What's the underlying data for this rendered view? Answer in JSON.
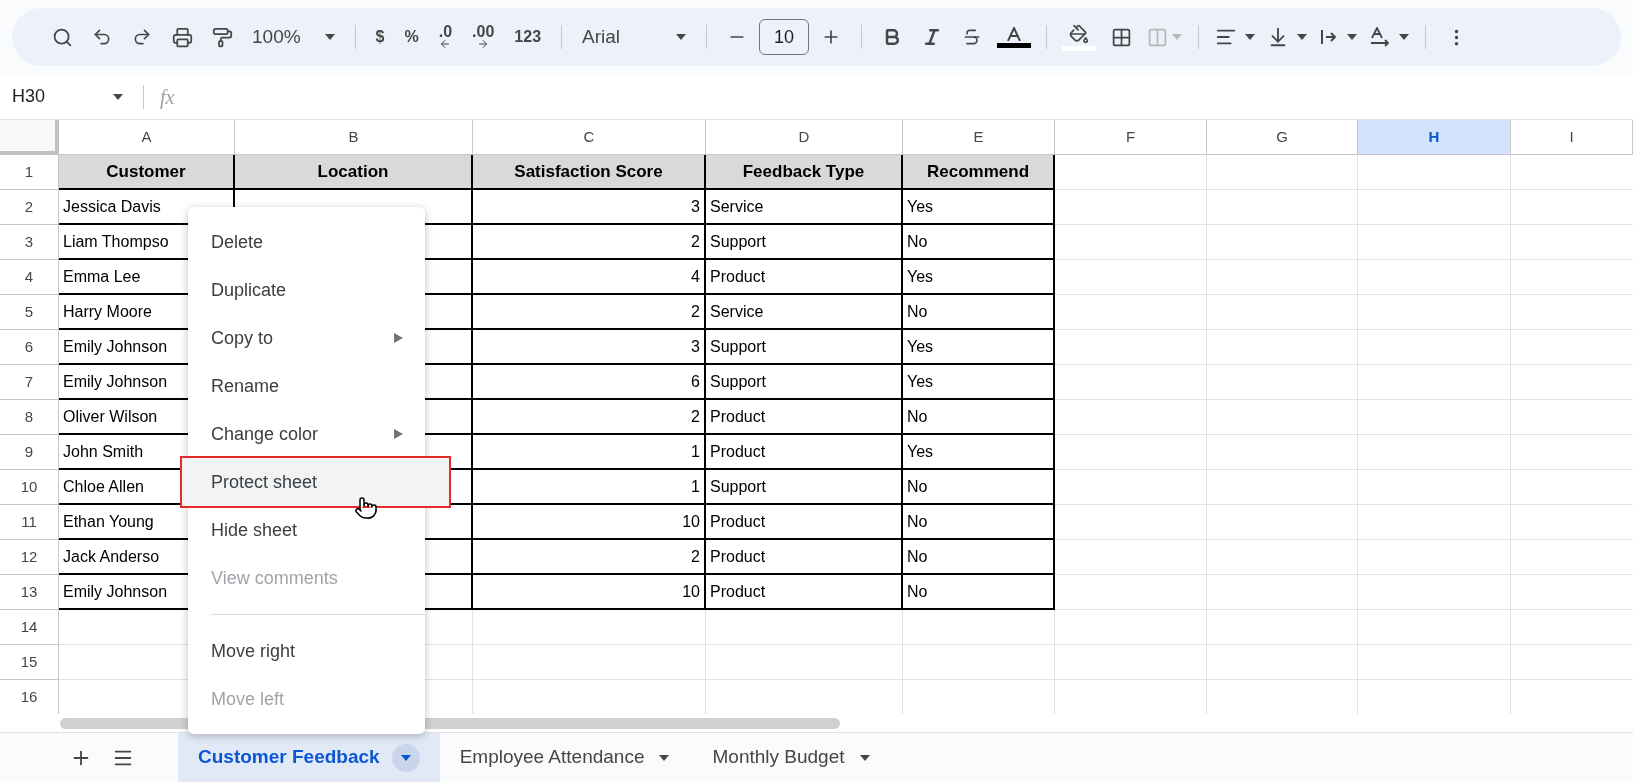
{
  "toolbar": {
    "zoom": "100%",
    "format_buttons": [
      {
        "label": "$",
        "kind": "plain"
      },
      {
        "label": "%",
        "kind": "plain"
      },
      {
        "label": ".0",
        "kind": "decrease"
      },
      {
        "label": ".00",
        "kind": "increase"
      },
      {
        "label": "123",
        "kind": "plain"
      }
    ],
    "font": "Arial",
    "font_size": "10"
  },
  "formula_bar": {
    "cell_ref": "H30",
    "fx": "fx"
  },
  "columns": [
    {
      "letter": "A",
      "selected": false
    },
    {
      "letter": "B",
      "selected": false
    },
    {
      "letter": "C",
      "selected": false
    },
    {
      "letter": "D",
      "selected": false
    },
    {
      "letter": "E",
      "selected": false
    },
    {
      "letter": "F",
      "selected": false
    },
    {
      "letter": "G",
      "selected": false
    },
    {
      "letter": "H",
      "selected": true
    },
    {
      "letter": "I",
      "selected": false
    }
  ],
  "row_numbers": [
    "1",
    "2",
    "3",
    "4",
    "5",
    "6",
    "7",
    "8",
    "9",
    "10",
    "11",
    "12",
    "13",
    "14",
    "15",
    "16"
  ],
  "table": {
    "header": [
      "Customer",
      "Location",
      "Satisfaction Score",
      "Feedback Type",
      "Recommend"
    ],
    "rows": [
      {
        "customer": "Jessica Davis",
        "score": "3",
        "feedback_type": "Service",
        "recommend": "Yes"
      },
      {
        "customer": "Liam Thompso",
        "score": "2",
        "feedback_type": "Support",
        "recommend": "No"
      },
      {
        "customer": "Emma Lee",
        "score": "4",
        "feedback_type": "Product",
        "recommend": "Yes"
      },
      {
        "customer": "Harry Moore",
        "score": "2",
        "feedback_type": "Service",
        "recommend": "No"
      },
      {
        "customer": "Emily Johnson",
        "score": "3",
        "feedback_type": "Support",
        "recommend": "Yes"
      },
      {
        "customer": "Emily Johnson",
        "score": "6",
        "feedback_type": "Support",
        "recommend": "Yes"
      },
      {
        "customer": "Oliver Wilson",
        "score": "2",
        "feedback_type": "Product",
        "recommend": "No"
      },
      {
        "customer": "John Smith",
        "score": "1",
        "feedback_type": "Product",
        "recommend": "Yes"
      },
      {
        "customer": "Chloe Allen",
        "score": "1",
        "feedback_type": "Support",
        "recommend": "No"
      },
      {
        "customer": "Ethan Young",
        "score": "10",
        "feedback_type": "Product",
        "recommend": "No"
      },
      {
        "customer": "Jack Anderso",
        "score": "2",
        "feedback_type": "Product",
        "recommend": "No"
      },
      {
        "customer": "Emily Johnson",
        "score": "10",
        "feedback_type": "Product",
        "recommend": "No"
      }
    ]
  },
  "context_menu": {
    "items": [
      {
        "kind": "item",
        "label": "Delete",
        "disabled": false,
        "submenu": false,
        "highlighted": false
      },
      {
        "kind": "item",
        "label": "Duplicate",
        "disabled": false,
        "submenu": false,
        "highlighted": false
      },
      {
        "kind": "item",
        "label": "Copy to",
        "disabled": false,
        "submenu": true,
        "highlighted": false
      },
      {
        "kind": "item",
        "label": "Rename",
        "disabled": false,
        "submenu": false,
        "highlighted": false
      },
      {
        "kind": "item",
        "label": "Change color",
        "disabled": false,
        "submenu": true,
        "highlighted": false
      },
      {
        "kind": "item",
        "label": "Protect sheet",
        "disabled": false,
        "submenu": false,
        "highlighted": true
      },
      {
        "kind": "item",
        "label": "Hide sheet",
        "disabled": false,
        "submenu": false,
        "highlighted": false
      },
      {
        "kind": "item",
        "label": "View comments",
        "disabled": true,
        "submenu": false,
        "highlighted": false
      },
      {
        "kind": "divider"
      },
      {
        "kind": "item",
        "label": "Move right",
        "disabled": false,
        "submenu": false,
        "highlighted": false
      },
      {
        "kind": "item",
        "label": "Move left",
        "disabled": true,
        "submenu": false,
        "highlighted": false
      }
    ]
  },
  "sheet_tabs": [
    {
      "label": "Customer Feedback",
      "selected": true
    },
    {
      "label": "Employee Attendance",
      "selected": false
    },
    {
      "label": "Monthly Budget",
      "selected": false
    }
  ]
}
